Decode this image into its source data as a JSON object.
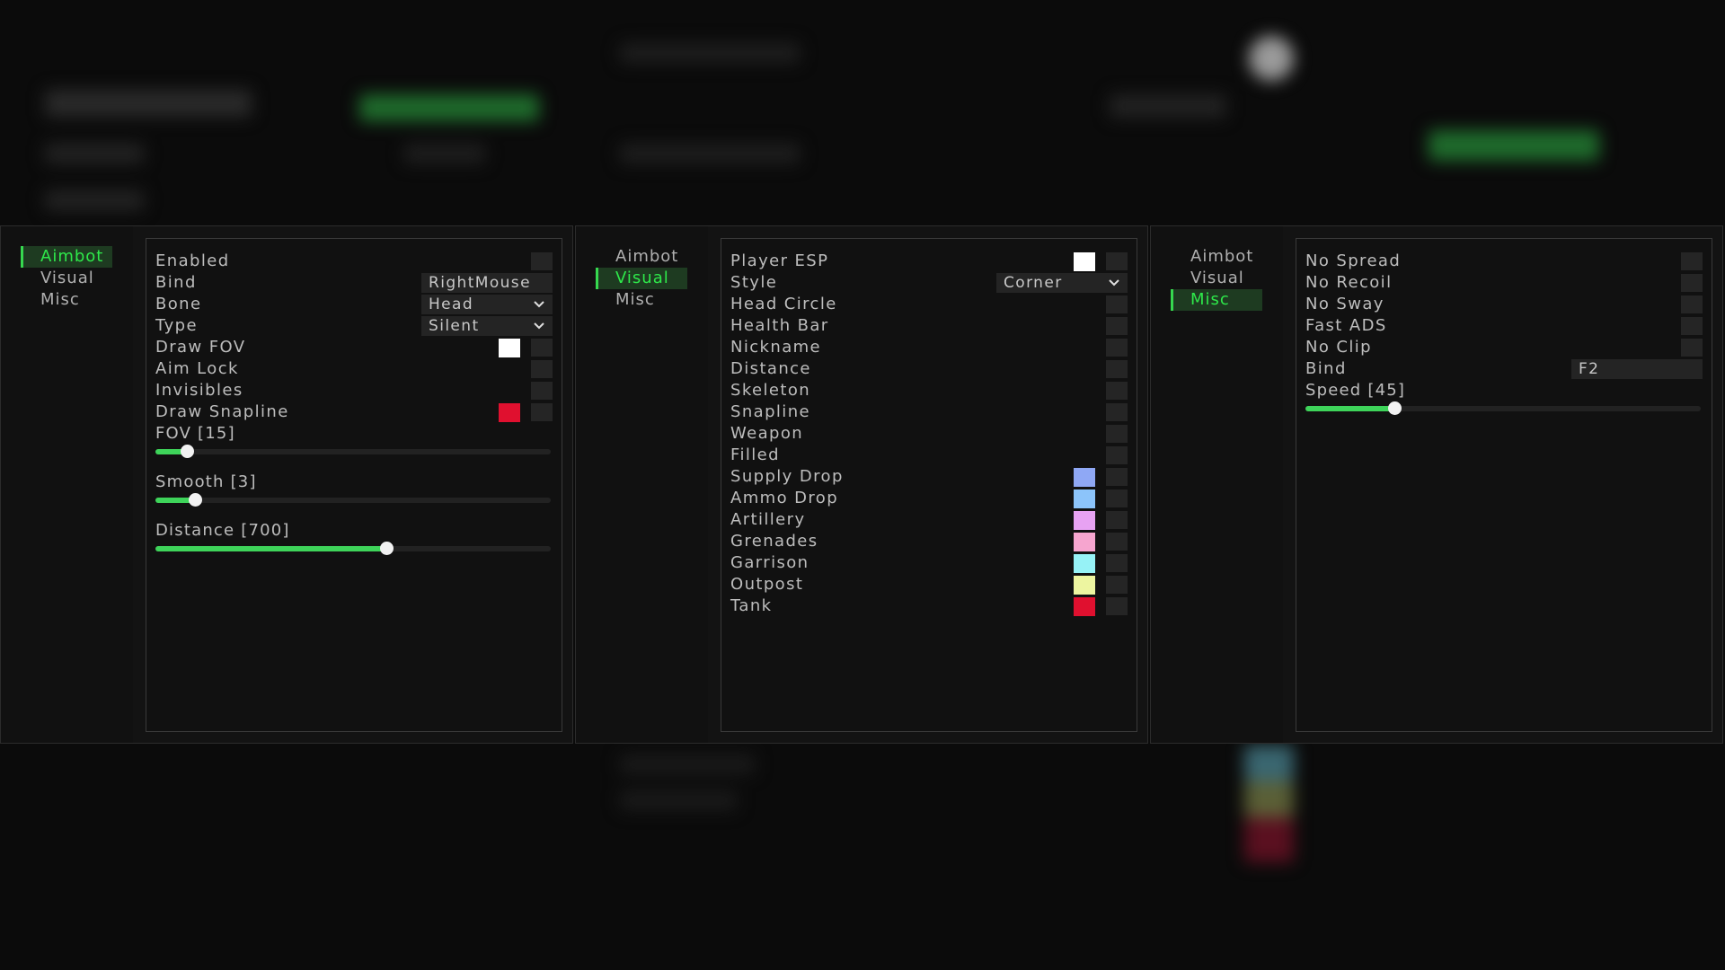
{
  "colors": {
    "accent": "#3ed45a",
    "active_tab_bg": "#1e3b21",
    "active_tab_text": "#2ee84a",
    "checkbox_bg": "#252525",
    "panel_bg": "#131313"
  },
  "menus": [
    {
      "tabs": [
        "Aimbot",
        "Visual",
        "Misc"
      ],
      "active_tab": 0,
      "rows": [
        {
          "label": "Enabled",
          "control": "checkbox"
        },
        {
          "label": "Bind",
          "control": "field",
          "value": "RightMouse"
        },
        {
          "label": "Bone",
          "control": "dropdown",
          "value": "Head"
        },
        {
          "label": "Type",
          "control": "dropdown",
          "value": "Silent"
        },
        {
          "label": "Draw FOV",
          "control": "checkbox",
          "swatch": "#ffffff"
        },
        {
          "label": "Aim Lock",
          "control": "checkbox"
        },
        {
          "label": "Invisibles",
          "control": "checkbox"
        },
        {
          "label": "Draw Snapline",
          "control": "checkbox",
          "swatch": "#e0102f"
        }
      ],
      "sliders": [
        {
          "label": "FOV [15]",
          "fraction": 0.08
        },
        {
          "label": "Smooth [3]",
          "fraction": 0.1
        },
        {
          "label": "Distance [700]",
          "fraction": 0.585
        }
      ]
    },
    {
      "tabs": [
        "Aimbot",
        "Visual",
        "Misc"
      ],
      "active_tab": 1,
      "rows": [
        {
          "label": "Player ESP",
          "control": "checkbox",
          "swatch": "#ffffff"
        },
        {
          "label": "Style",
          "control": "dropdown",
          "value": "Corner"
        },
        {
          "label": "Head Circle",
          "control": "checkbox"
        },
        {
          "label": "Health Bar",
          "control": "checkbox"
        },
        {
          "label": "Nickname",
          "control": "checkbox"
        },
        {
          "label": "Distance",
          "control": "checkbox"
        },
        {
          "label": "Skeleton",
          "control": "checkbox"
        },
        {
          "label": "Snapline",
          "control": "checkbox"
        },
        {
          "label": "Weapon",
          "control": "checkbox"
        },
        {
          "label": "Filled",
          "control": "checkbox"
        },
        {
          "label": "Supply Drop",
          "control": "checkbox",
          "swatch": "#8fa8f5"
        },
        {
          "label": "Ammo Drop",
          "control": "checkbox",
          "swatch": "#8cc4fa"
        },
        {
          "label": "Artillery",
          "control": "checkbox",
          "swatch": "#e7a2f3"
        },
        {
          "label": "Grenades",
          "control": "checkbox",
          "swatch": "#f6a5cf"
        },
        {
          "label": "Garrison",
          "control": "checkbox",
          "swatch": "#96f2f6"
        },
        {
          "label": "Outpost",
          "control": "checkbox",
          "swatch": "#edf5a0"
        },
        {
          "label": "Tank",
          "control": "checkbox",
          "swatch": "#e0102f"
        }
      ],
      "sliders": []
    },
    {
      "tabs": [
        "Aimbot",
        "Visual",
        "Misc"
      ],
      "active_tab": 2,
      "rows": [
        {
          "label": "No Spread",
          "control": "checkbox"
        },
        {
          "label": "No Recoil",
          "control": "checkbox"
        },
        {
          "label": "No Sway",
          "control": "checkbox"
        },
        {
          "label": "Fast ADS",
          "control": "checkbox"
        },
        {
          "label": "No Clip",
          "control": "checkbox"
        },
        {
          "label": "Bind",
          "control": "field",
          "value": "F2"
        }
      ],
      "sliders": [
        {
          "label": "Speed [45]",
          "fraction": 0.225
        }
      ]
    }
  ]
}
